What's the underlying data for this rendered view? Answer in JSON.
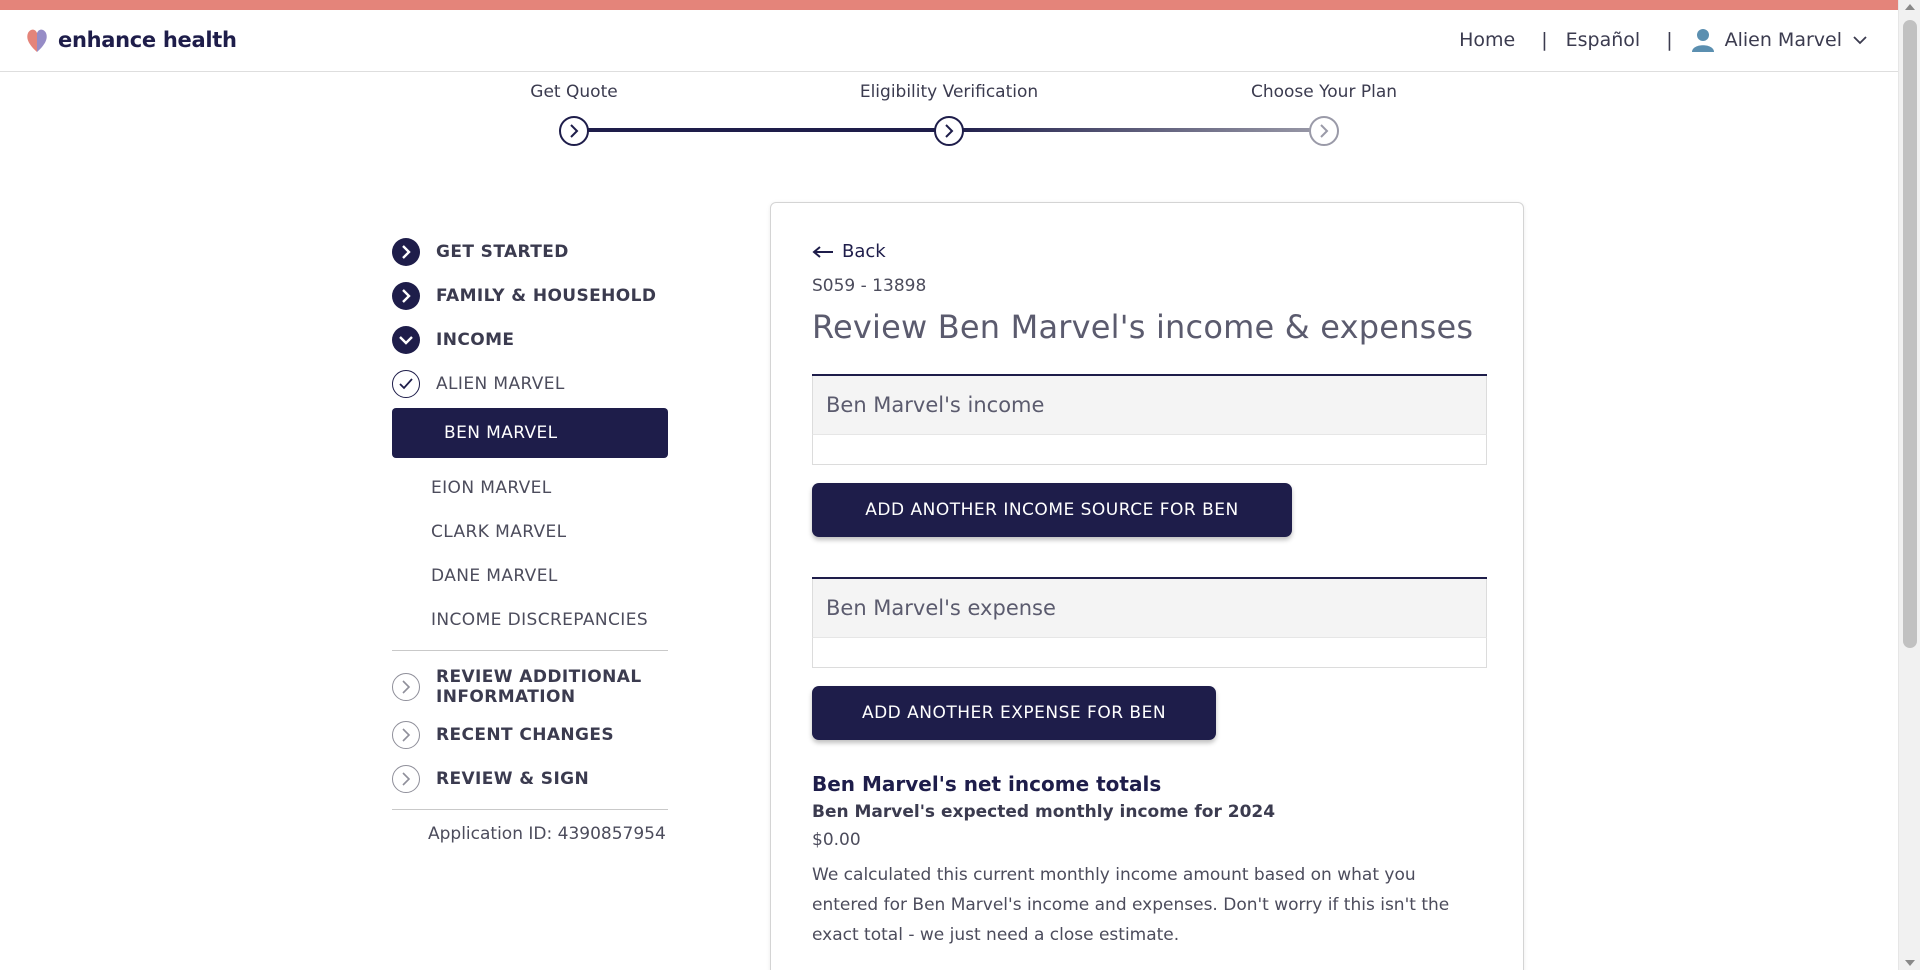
{
  "header": {
    "logo_text": "enhance health",
    "nav_home": "Home",
    "nav_separator": "|",
    "nav_language": "Español",
    "user_name": "Alien Marvel"
  },
  "stepper": {
    "steps": [
      {
        "label": "Get Quote",
        "state": "complete"
      },
      {
        "label": "Eligibility Verification",
        "state": "current"
      },
      {
        "label": "Choose Your Plan",
        "state": "upcoming"
      }
    ]
  },
  "sidebar": {
    "sections": {
      "get_started": "GET STARTED",
      "family_household": "FAMILY & HOUSEHOLD",
      "income": "INCOME",
      "review_additional": "REVIEW ADDITIONAL INFORMATION",
      "recent_changes": "RECENT CHANGES",
      "review_sign": "REVIEW & SIGN"
    },
    "income_members": {
      "alien": "ALIEN MARVEL",
      "ben": "BEN MARVEL",
      "eion": "EION MARVEL",
      "clark": "CLARK MARVEL",
      "dane": "DANE MARVEL",
      "discrepancies": "INCOME DISCREPANCIES"
    },
    "application_id": "Application ID: 4390857954"
  },
  "main": {
    "back_label": "Back",
    "case_id": "S059 - 13898",
    "title": "Review Ben Marvel's income & expenses",
    "income_section_title": "Ben Marvel's income",
    "add_income_button": "ADD ANOTHER INCOME SOURCE FOR BEN",
    "expense_section_title": "Ben Marvel's expense",
    "add_expense_button": "ADD ANOTHER EXPENSE FOR BEN",
    "totals_title": "Ben Marvel's net income totals",
    "totals_subtitle": "Ben Marvel's expected monthly income for 2024",
    "totals_value": "$0.00",
    "totals_description": "We calculated this current monthly income amount based on what you entered for Ben Marvel's income and expenses. Don't worry if this isn't the exact total - we just need a close estimate."
  },
  "colors": {
    "accent_bar": "#e4847a",
    "primary_navy": "#1e1d4a",
    "section_head_bg": "#f4f4f4"
  }
}
